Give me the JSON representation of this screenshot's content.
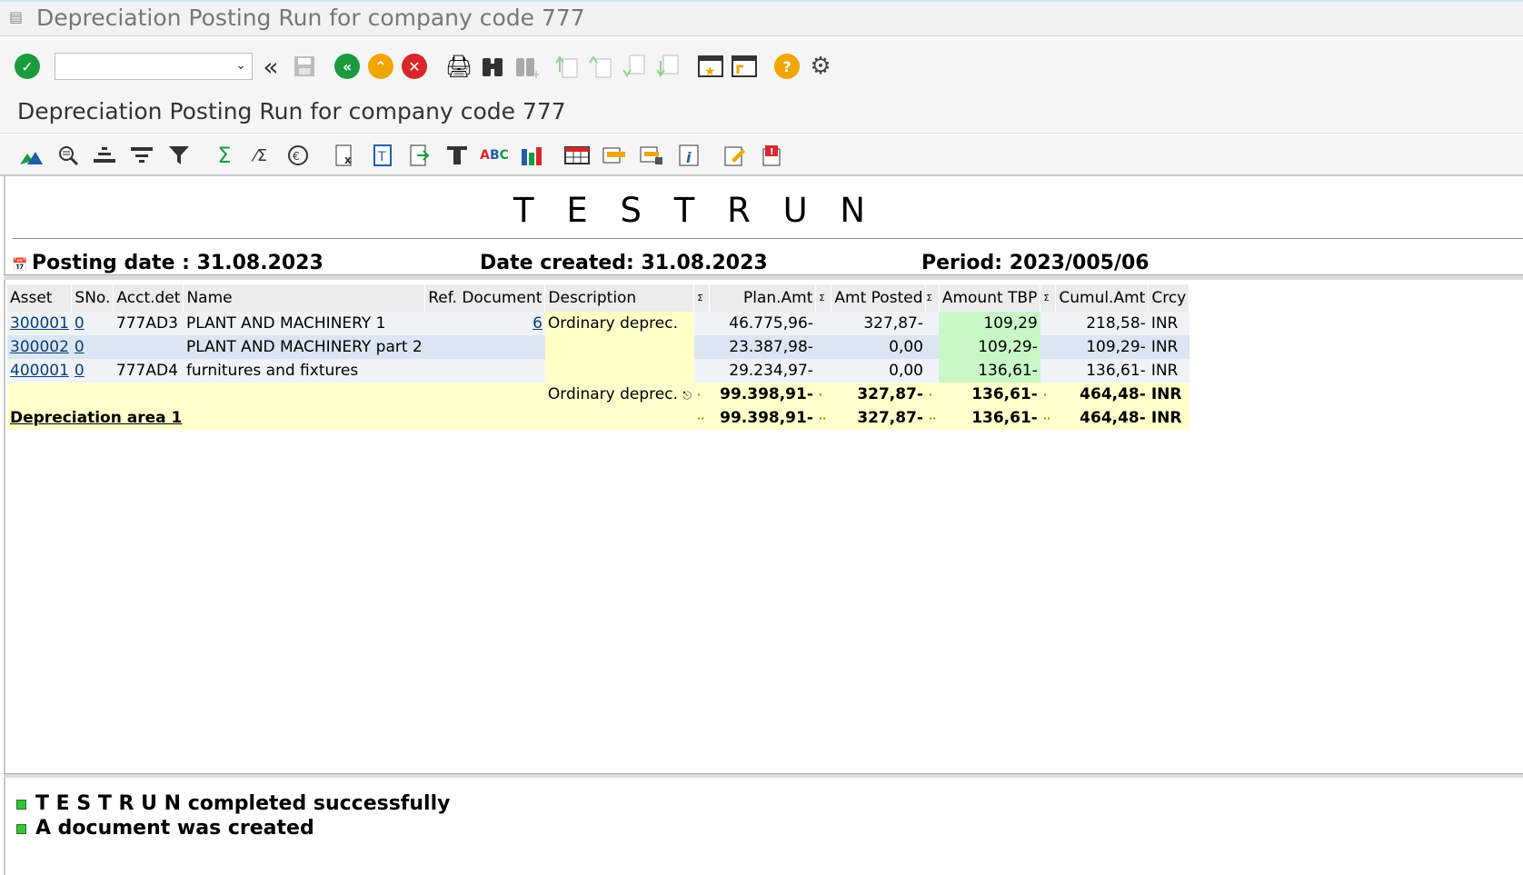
{
  "window": {
    "title": "Depreciation Posting Run for company code 777"
  },
  "toolbar": {
    "command_field": {
      "value": "",
      "placeholder": ""
    },
    "icons": [
      "check-icon",
      "back-arrows-icon",
      "save-icon",
      "back-icon",
      "exit-icon",
      "cancel-icon",
      "print-icon",
      "find-icon",
      "find-next-icon",
      "first-page-icon",
      "previous-page-icon",
      "next-page-icon",
      "last-page-icon",
      "create-session-icon",
      "shortcut-icon",
      "help-icon",
      "settings-icon"
    ]
  },
  "screen": {
    "title": "Depreciation Posting Run for company code 777"
  },
  "report": {
    "heading": "T E S T R U N",
    "posting_date": "Posting date : 31.08.2023",
    "date_created": "Date created: 31.08.2023",
    "period": "Period: 2023/005/06"
  },
  "grid": {
    "columns": [
      "Asset",
      "SNo.",
      "Acct.det",
      "Name",
      "Ref. Document",
      "Description",
      "Σ",
      "Plan.Amt",
      "Σ",
      "Amt Posted",
      "Σ",
      "Amount TBP",
      "Σ",
      "Cumul.Amt",
      "Crcy"
    ],
    "rows": [
      {
        "asset": "300001",
        "sno": "0",
        "acctdet": "777AD3",
        "name": "PLANT AND MACHINERY 1",
        "refdoc": "6",
        "description": "Ordinary deprec.",
        "plan": "46.775,96-",
        "posted": "327,87-",
        "tbp": "109,29",
        "cumul": "218,58-",
        "crcy": "INR"
      },
      {
        "asset": "300002",
        "sno": "0",
        "acctdet": "",
        "name": "PLANT AND MACHINERY part 2",
        "refdoc": "",
        "description": "",
        "plan": "23.387,98-",
        "posted": "0,00",
        "tbp": "109,29-",
        "cumul": "109,29-",
        "crcy": "INR"
      },
      {
        "asset": "400001",
        "sno": "0",
        "acctdet": "777AD4",
        "name": "furnitures and fixtures",
        "refdoc": "",
        "description": "",
        "plan": "29.234,97-",
        "posted": "0,00",
        "tbp": "136,61-",
        "cumul": "136,61-",
        "crcy": "INR"
      }
    ],
    "subtotal": {
      "label": "Ordinary deprec.",
      "plan": "99.398,91-",
      "posted": "327,87-",
      "tbp": "136,61-",
      "cumul": "464,48-",
      "crcy": "INR"
    },
    "total": {
      "label": "Depreciation area  1",
      "plan": "99.398,91-",
      "posted": "327,87-",
      "tbp": "136,61-",
      "cumul": "464,48-",
      "crcy": "INR"
    }
  },
  "messages": [
    "T E S T R U N completed successfully",
    "A document was created"
  ],
  "colors": {
    "success": "#3cbf3c",
    "highlight_green": "#c8f7c8",
    "highlight_yellow": "#ffffcc"
  }
}
